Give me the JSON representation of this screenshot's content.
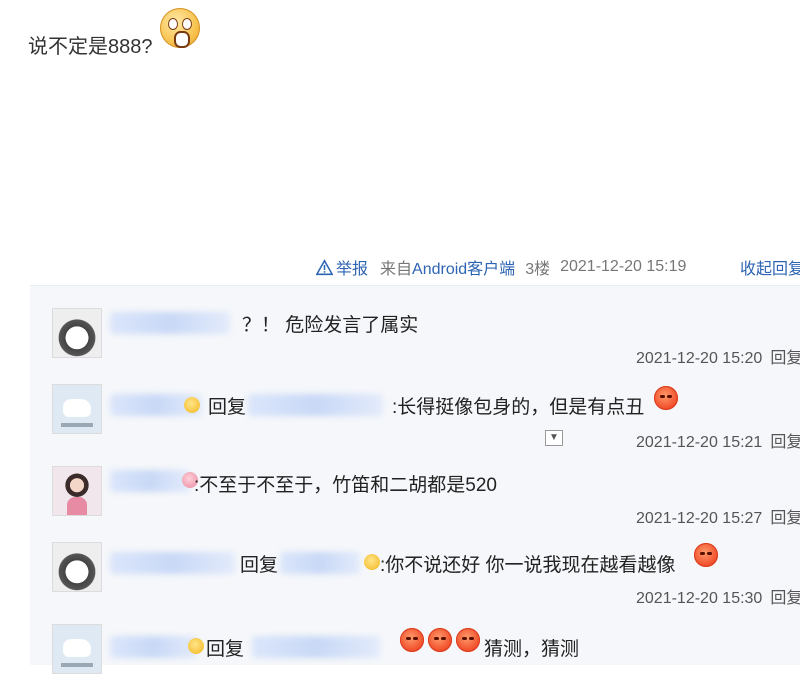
{
  "post": {
    "text": "说不定是888?"
  },
  "meta": {
    "report": "举报",
    "source_prefix": "来自",
    "source_app": "Android客户端",
    "floor": "3楼",
    "time": "2021-12-20 15:19",
    "collapse": "收起回复"
  },
  "replies": [
    {
      "text": "？！ 危险发言了属实",
      "time": "2021-12-20 15:20",
      "reply": "回复"
    },
    {
      "reply_word": "回复",
      "text": ":长得挺像包身的，但是有点丑",
      "time": "2021-12-20 15:21",
      "reply": "回复"
    },
    {
      "text": ":不至于不至于，竹笛和二胡都是520",
      "time": "2021-12-20 15:27",
      "reply": "回复"
    },
    {
      "reply_word": "回复",
      "text": ":你不说还好 你一说我现在越看越像",
      "time": "2021-12-20 15:30",
      "reply": "回复"
    },
    {
      "reply_word": "回复",
      "text": "猜测，猜测"
    }
  ],
  "icons": {
    "report": "warning-triangle-icon",
    "post_emoji": "shocked-face-emoji",
    "angry": "angry-face-emoji",
    "expand": "chevron-down-icon"
  },
  "colors": {
    "link": "#2d64b3",
    "reply_bg": "#f5f7fa"
  }
}
